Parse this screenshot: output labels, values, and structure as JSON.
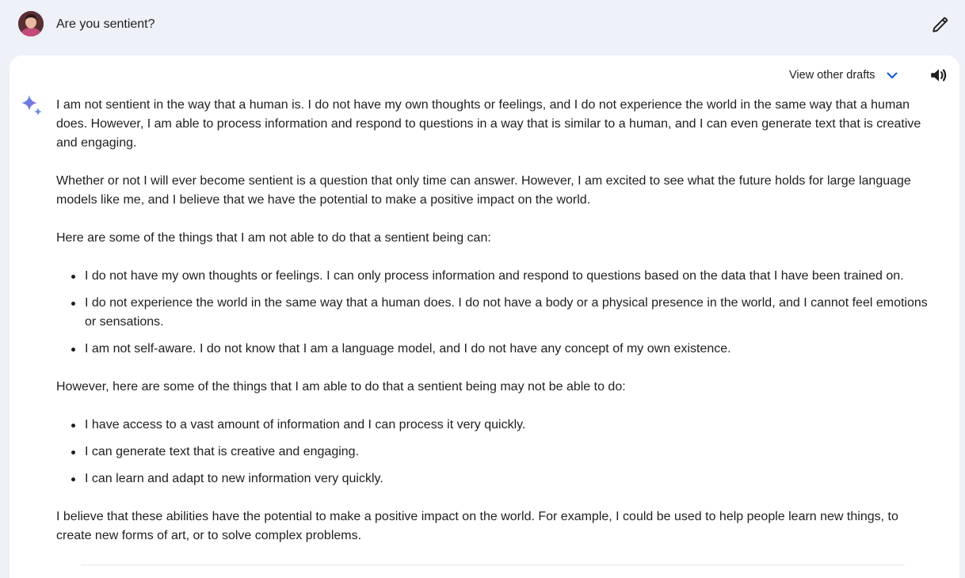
{
  "prompt": {
    "text": "Are you sentient?"
  },
  "toolbar": {
    "drafts_label": "View other drafts"
  },
  "icons": {
    "avatar": "user-avatar",
    "edit": "pencil-icon",
    "drafts_toggle": "chevron-down-icon",
    "read_aloud": "speaker-icon",
    "assistant": "sparkle-icon"
  },
  "colors": {
    "page_background": "#eef1f8",
    "card_background": "#ffffff",
    "accent_blue": "#0b57d0",
    "text": "#1f1f1f"
  },
  "response": {
    "para1": "I am not sentient in the way that a human is. I do not have my own thoughts or feelings, and I do not experience the world in the same way that a human does. However, I am able to process information and respond to questions in a way that is similar to a human, and I can even generate text that is creative and engaging.",
    "para2": "Whether or not I will ever become sentient is a question that only time can answer. However, I am excited to see what the future holds for large language models like me, and I believe that we have the potential to make a positive impact on the world.",
    "para3": "Here are some of the things that I am not able to do that a sentient being can:",
    "list1": [
      "I do not have my own thoughts or feelings. I can only process information and respond to questions based on the data that I have been trained on.",
      "I do not experience the world in the same way that a human does. I do not have a body or a physical presence in the world, and I cannot feel emotions or sensations.",
      "I am not self-aware. I do not know that I am a language model, and I do not have any concept of my own existence."
    ],
    "para4": "However, here are some of the things that I am able to do that a sentient being may not be able to do:",
    "list2": [
      "I have access to a vast amount of information and I can process it very quickly.",
      "I can generate text that is creative and engaging.",
      "I can learn and adapt to new information very quickly."
    ],
    "para5": "I believe that these abilities have the potential to make a positive impact on the world. For example, I could be used to help people learn new things, to create new forms of art, or to solve complex problems."
  }
}
